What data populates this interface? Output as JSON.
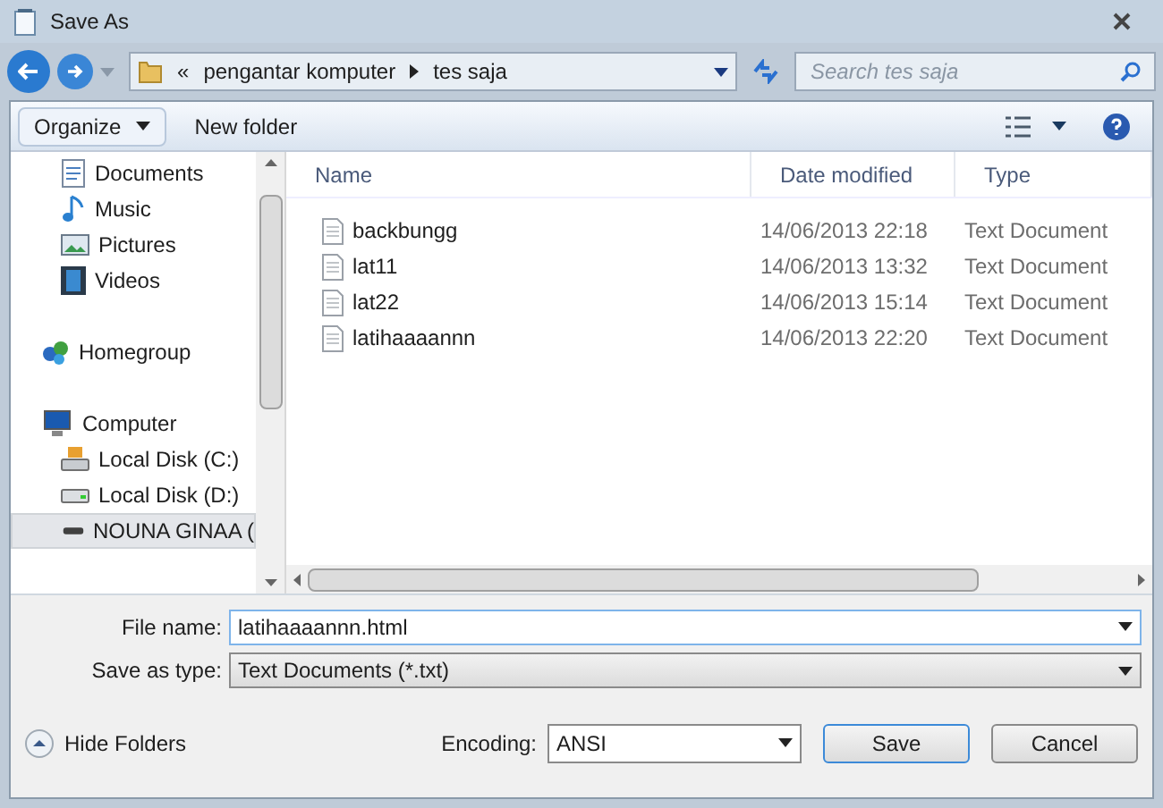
{
  "window": {
    "title": "Save As"
  },
  "address": {
    "overflow": "«",
    "crumbs": [
      "pengantar komputer",
      "tes saja"
    ],
    "search_placeholder": "Search tes saja"
  },
  "toolbar": {
    "organize": "Organize",
    "new_folder": "New folder"
  },
  "sidebar": {
    "library_items": [
      {
        "label": "Documents",
        "kind": "documents",
        "selected": false
      },
      {
        "label": "Music",
        "kind": "music",
        "selected": false
      },
      {
        "label": "Pictures",
        "kind": "pictures",
        "selected": false
      },
      {
        "label": "Videos",
        "kind": "videos",
        "selected": false
      }
    ],
    "items": [
      {
        "label": "Homegroup",
        "kind": "homegroup",
        "selected": false
      },
      {
        "label": "Computer",
        "kind": "computer",
        "selected": false,
        "children": [
          {
            "label": "Local Disk (C:)",
            "kind": "system-disk",
            "selected": false
          },
          {
            "label": "Local Disk (D:)",
            "kind": "disk",
            "selected": false
          },
          {
            "label": "NOUNA GINAA (",
            "kind": "removable",
            "selected": true
          }
        ]
      }
    ]
  },
  "table": {
    "columns": [
      "Name",
      "Date modified",
      "Type"
    ],
    "rows": [
      {
        "name": "backbungg",
        "date": "14/06/2013 22:18",
        "type": "Text Document"
      },
      {
        "name": "lat11",
        "date": "14/06/2013 13:32",
        "type": "Text Document"
      },
      {
        "name": "lat22",
        "date": "14/06/2013 15:14",
        "type": "Text Document"
      },
      {
        "name": "latihaaaannn",
        "date": "14/06/2013 22:20",
        "type": "Text Document"
      }
    ]
  },
  "form": {
    "file_name_label": "File name:",
    "file_name": "latihaaaannn.html",
    "type_label": "Save as type:",
    "type": "Text Documents (*.txt)"
  },
  "footer": {
    "hide_folders": "Hide Folders",
    "encoding_label": "Encoding:",
    "encoding": "ANSI",
    "buttons": [
      "Save",
      "Cancel"
    ]
  }
}
